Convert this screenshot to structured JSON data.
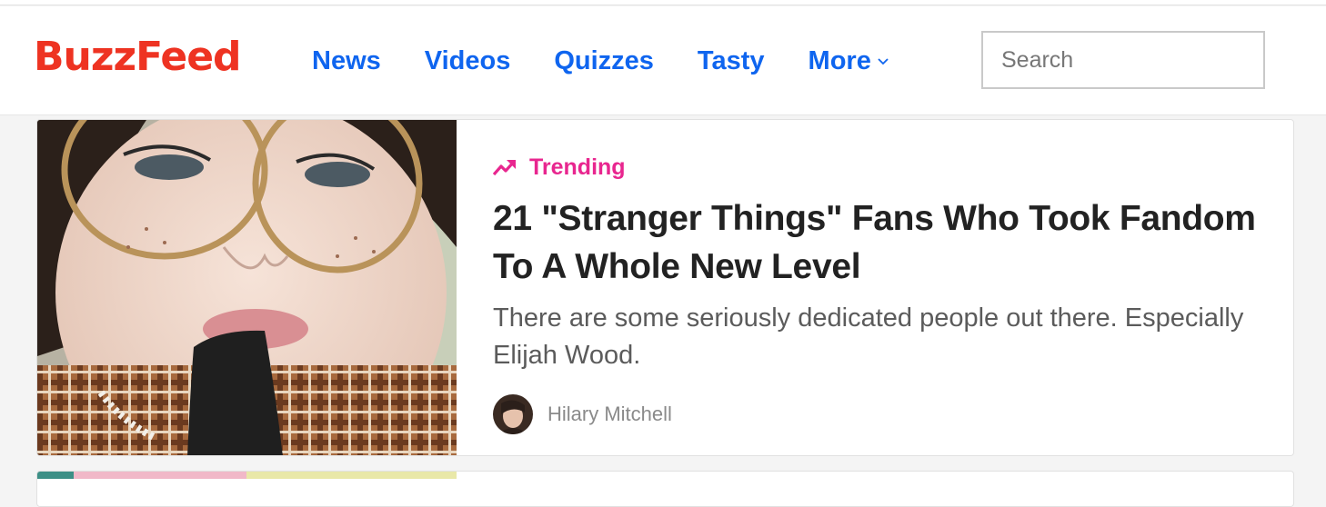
{
  "header": {
    "logo": "BuzzFeed",
    "nav": [
      {
        "label": "News"
      },
      {
        "label": "Videos"
      },
      {
        "label": "Quizzes"
      },
      {
        "label": "Tasty"
      },
      {
        "label": "More"
      }
    ],
    "search": {
      "placeholder": "Search",
      "value": ""
    }
  },
  "card": {
    "badge": "Trending",
    "headline": "21 \"Stranger Things\" Fans Who Took Fandom To A Whole New Level",
    "description": "There are some seriously dedicated people out there. Especially Elijah Wood.",
    "author": "Hilary Mitchell"
  },
  "colors": {
    "brand": "#ee3322",
    "link": "#0f65ef",
    "trending": "#e8268f",
    "headline": "#222222"
  }
}
